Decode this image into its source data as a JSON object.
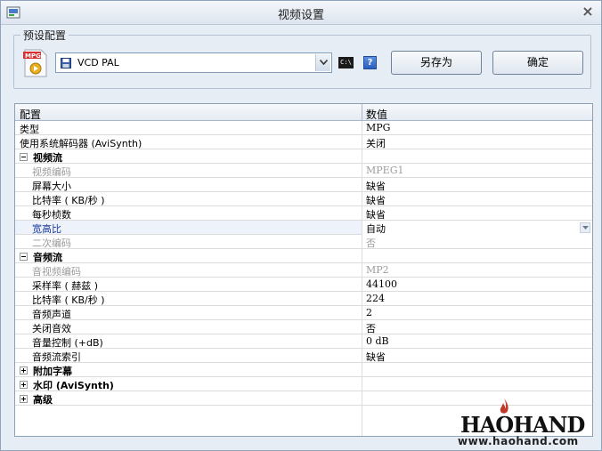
{
  "window": {
    "title": "视频设置",
    "close_glyph": "×"
  },
  "preset": {
    "legend": "预设配置",
    "format_icon_label": "MPG",
    "selected": "VCD PAL",
    "console_label": "C:\\",
    "help_label": "?",
    "save_as_label": "另存为",
    "ok_label": "确定"
  },
  "grid": {
    "col_name": "配置",
    "col_value": "数值",
    "rows": {
      "type_name": "类型",
      "type_value": "MPG",
      "sysdec_name": "使用系统解码器 (AviSynth)",
      "sysdec_value": "关闭",
      "video_group": "视频流",
      "vcodec_name": "视频编码",
      "vcodec_value": "MPEG1",
      "size_name": "屏幕大小",
      "size_value": "缺省",
      "vbitrate_name": "比特率 ( KB/秒 )",
      "vbitrate_value": "缺省",
      "fps_name": "每秒桢数",
      "fps_value": "缺省",
      "aspect_name": "宽高比",
      "aspect_value": "自动",
      "twopass_name": "二次编码",
      "twopass_value": "否",
      "audio_group": "音频流",
      "acodec_name": "音视频编码",
      "acodec_value": "MP2",
      "samplerate_name": "采样率 ( 赫兹 )",
      "samplerate_value": "44100",
      "abitrate_name": "比特率 ( KB/秒 )",
      "abitrate_value": "224",
      "channels_name": "音频声道",
      "channels_value": "2",
      "mute_name": "关闭音效",
      "mute_value": "否",
      "volume_name": "音量控制 (+dB)",
      "volume_value": "0 dB",
      "stream_index_name": "音频流索引",
      "stream_index_value": "缺省",
      "subtitle_group": "附加字幕",
      "watermark_group": "水印 (AviSynth)",
      "advanced_group": "高级"
    }
  },
  "watermark": {
    "logo": "HAOHAND",
    "url": "www.haohand.com"
  },
  "colors": {
    "accent": "#1a3a9c",
    "disabled": "#9c9c9c",
    "flame": "#c0392b"
  }
}
